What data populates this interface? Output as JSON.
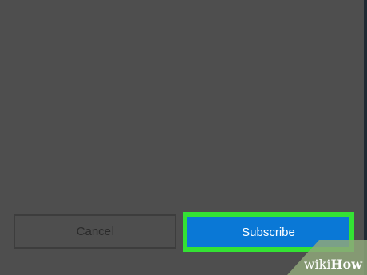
{
  "dialog": {
    "cancel_label": "Cancel",
    "subscribe_label": "Subscribe"
  },
  "watermark": {
    "part1": "wiki",
    "part2": "How"
  },
  "colors": {
    "background": "#4e4e4e",
    "primary_button": "#0a78d6",
    "highlight": "#34e234"
  }
}
